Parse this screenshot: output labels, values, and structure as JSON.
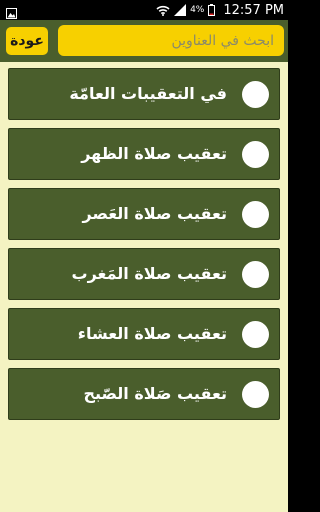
{
  "status_bar": {
    "battery_percent": "4%",
    "time": "12:57 PM"
  },
  "header": {
    "back_label": "عودة",
    "search_placeholder": "ابحث في العناوين"
  },
  "list": {
    "items": [
      {
        "label": "في التعقيبات العامّة"
      },
      {
        "label": "تعقيب صلاة الظهر"
      },
      {
        "label": "تعقيب صلاة العَصر"
      },
      {
        "label": "تعقيب صلاة المَغرب"
      },
      {
        "label": "تعقيب صلاة العشاء"
      },
      {
        "label": "تعقيب صَلاة الصّبح"
      }
    ]
  }
}
